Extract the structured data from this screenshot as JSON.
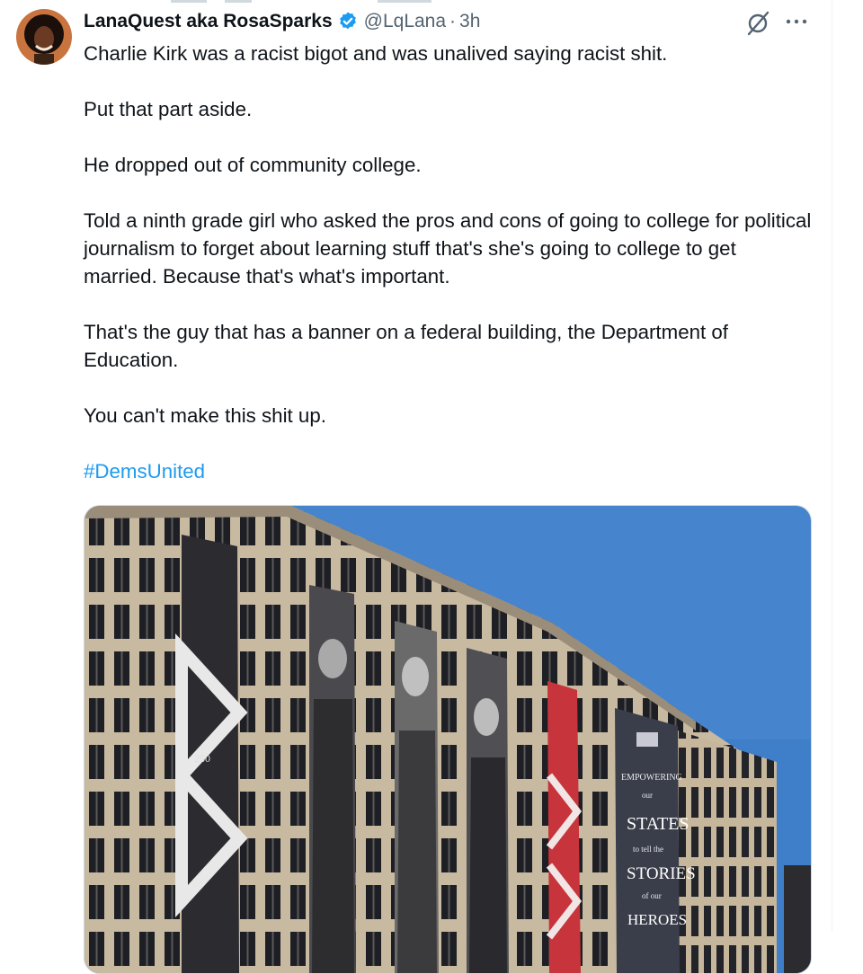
{
  "tweet": {
    "author": {
      "display_name": "LanaQuest aka RosaSparks",
      "handle": "@LqLana",
      "verified": true,
      "avatar_icon": "profile-photo"
    },
    "separator": "·",
    "time": "3h",
    "text": [
      "Charlie Kirk was a racist bigot and was unalived saying racist shit.",
      "Put that part aside.",
      "He dropped out of community college.",
      "Told a ninth grade girl who asked the pros and cons of going to college for political journalism to forget about learning stuff that's she's going to college to get married. Because that's what's important.",
      "That's the guy that has a banner on a federal building, the Department of Education.",
      "You can't make this shit up."
    ],
    "hashtag": "#DemsUnited",
    "actions": {
      "grok_icon": "grok-icon",
      "more_icon": "more-horizontal-icon"
    },
    "media": {
      "banner_texts": [
        "250",
        "EMPOWERING",
        "our",
        "STATES",
        "to tell the",
        "STORIES",
        "of our",
        "HEROES"
      ]
    }
  },
  "colors": {
    "link": "#1d9bf0",
    "secondary_text": "#536471",
    "verified": "#1d9bf0",
    "sky": "#3f7ec8"
  }
}
